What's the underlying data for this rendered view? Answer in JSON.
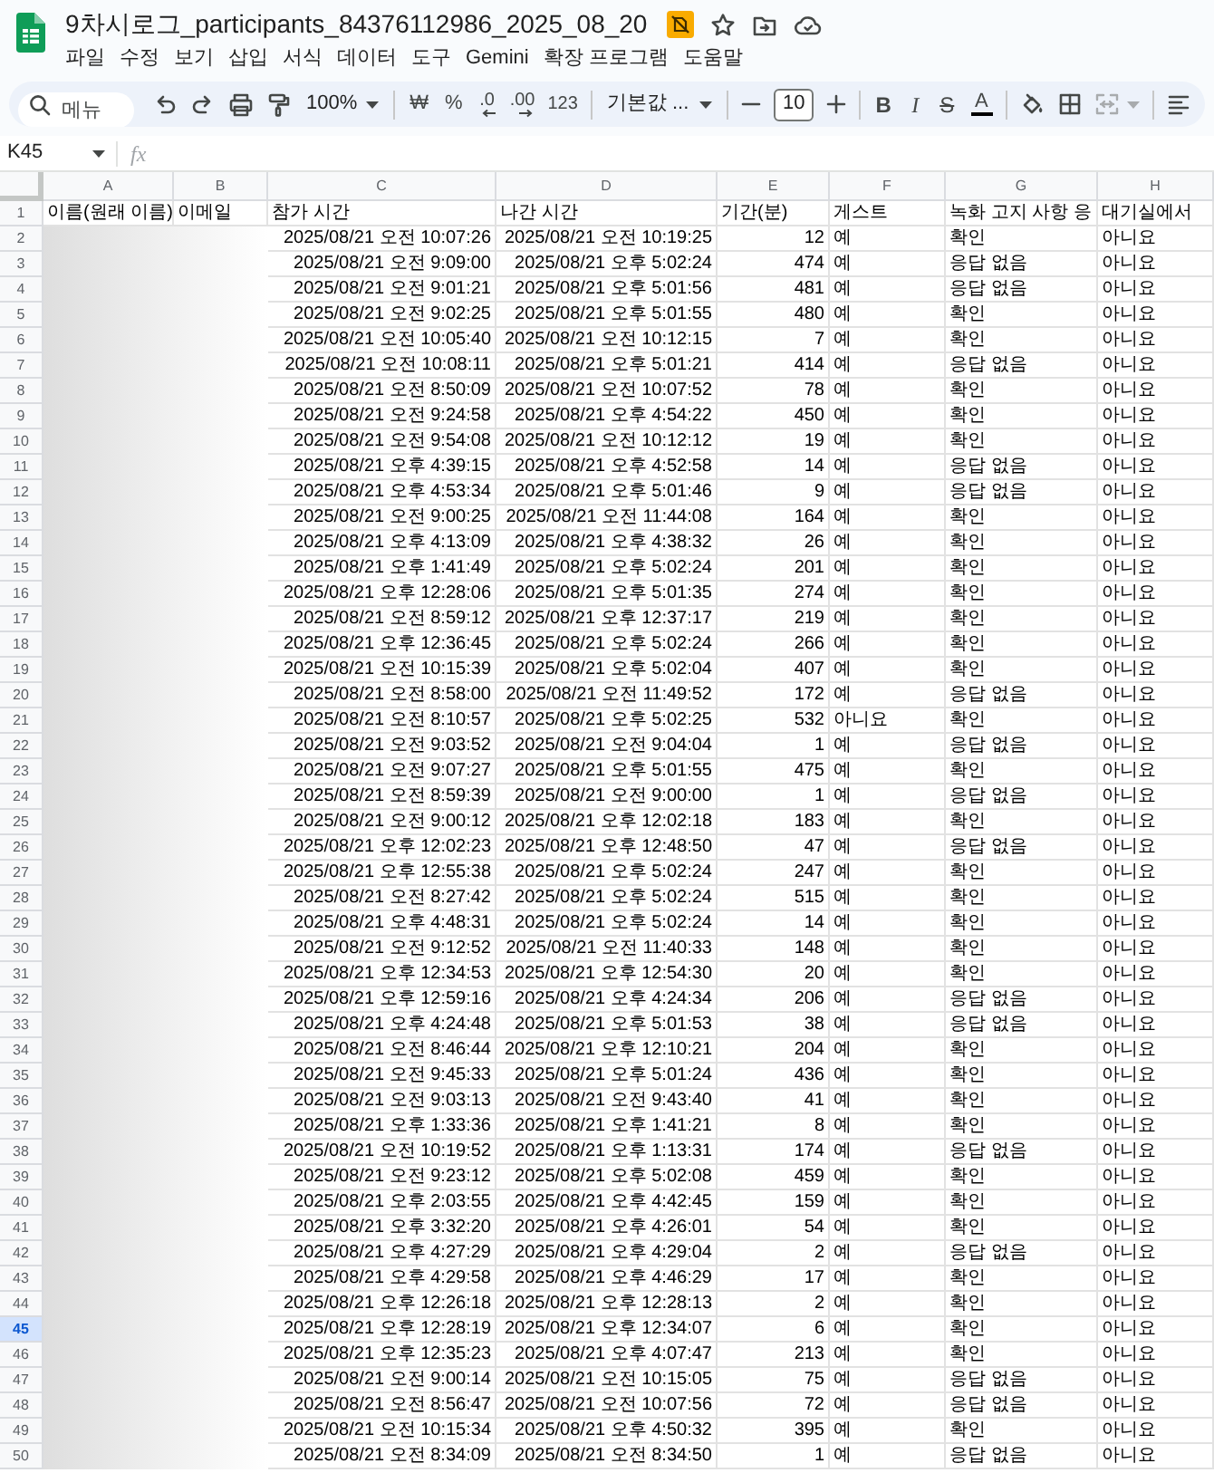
{
  "document": {
    "title": "9차시로그_participants_84376112986_2025_08_20",
    "menu": [
      "파일",
      "수정",
      "보기",
      "삽입",
      "서식",
      "데이터",
      "도구",
      "Gemini",
      "확장 프로그램",
      "도움말"
    ]
  },
  "toolbar": {
    "search": {
      "placeholder": "메뉴"
    },
    "zoom": "100%",
    "currency": "₩",
    "percent": "%",
    "decrease_decimal": ".0",
    "increase_decimal": ".00",
    "number_format": "123",
    "font": "기본값 ...",
    "font_size": "10",
    "bold": "B",
    "italic": "I",
    "strikethrough": "S",
    "text_color": "A"
  },
  "formula_bar": {
    "cell_reference": "K45",
    "fx": "fx"
  },
  "sheet": {
    "columns": [
      "A",
      "B",
      "C",
      "D",
      "E",
      "F",
      "G",
      "H"
    ],
    "header_row": {
      "number": "1",
      "selected": false,
      "cells": [
        "이름(원래 이름)",
        "이메일",
        "참가 시간",
        "나간 시간",
        "기간(분)",
        "게스트",
        "녹화 고지 사항 응",
        "대기실에서"
      ]
    },
    "rows": [
      {
        "number": "2",
        "selected": false,
        "cells": [
          "",
          "",
          "2025/08/21 오전 10:07:26",
          "2025/08/21 오전 10:19:25",
          "12",
          "예",
          "확인",
          "아니요"
        ]
      },
      {
        "number": "3",
        "selected": false,
        "cells": [
          "",
          "",
          "2025/08/21 오전 9:09:00",
          "2025/08/21 오후 5:02:24",
          "474",
          "예",
          "응답 없음",
          "아니요"
        ]
      },
      {
        "number": "4",
        "selected": false,
        "cells": [
          "",
          "",
          "2025/08/21 오전 9:01:21",
          "2025/08/21 오후 5:01:56",
          "481",
          "예",
          "응답 없음",
          "아니요"
        ]
      },
      {
        "number": "5",
        "selected": false,
        "cells": [
          "",
          "",
          "2025/08/21 오전 9:02:25",
          "2025/08/21 오후 5:01:55",
          "480",
          "예",
          "확인",
          "아니요"
        ]
      },
      {
        "number": "6",
        "selected": false,
        "cells": [
          "",
          "",
          "2025/08/21 오전 10:05:40",
          "2025/08/21 오전 10:12:15",
          "7",
          "예",
          "확인",
          "아니요"
        ]
      },
      {
        "number": "7",
        "selected": false,
        "cells": [
          "",
          "",
          "2025/08/21 오전 10:08:11",
          "2025/08/21 오후 5:01:21",
          "414",
          "예",
          "응답 없음",
          "아니요"
        ]
      },
      {
        "number": "8",
        "selected": false,
        "cells": [
          "",
          "",
          "2025/08/21 오전 8:50:09",
          "2025/08/21 오전 10:07:52",
          "78",
          "예",
          "확인",
          "아니요"
        ]
      },
      {
        "number": "9",
        "selected": false,
        "cells": [
          "",
          "",
          "2025/08/21 오전 9:24:58",
          "2025/08/21 오후 4:54:22",
          "450",
          "예",
          "확인",
          "아니요"
        ]
      },
      {
        "number": "10",
        "selected": false,
        "cells": [
          "",
          "",
          "2025/08/21 오전 9:54:08",
          "2025/08/21 오전 10:12:12",
          "19",
          "예",
          "확인",
          "아니요"
        ]
      },
      {
        "number": "11",
        "selected": false,
        "cells": [
          "",
          "",
          "2025/08/21 오후 4:39:15",
          "2025/08/21 오후 4:52:58",
          "14",
          "예",
          "응답 없음",
          "아니요"
        ]
      },
      {
        "number": "12",
        "selected": false,
        "cells": [
          "",
          "",
          "2025/08/21 오후 4:53:34",
          "2025/08/21 오후 5:01:46",
          "9",
          "예",
          "응답 없음",
          "아니요"
        ]
      },
      {
        "number": "13",
        "selected": false,
        "cells": [
          "",
          "",
          "2025/08/21 오전 9:00:25",
          "2025/08/21 오전 11:44:08",
          "164",
          "예",
          "확인",
          "아니요"
        ]
      },
      {
        "number": "14",
        "selected": false,
        "cells": [
          "",
          "",
          "2025/08/21 오후 4:13:09",
          "2025/08/21 오후 4:38:32",
          "26",
          "예",
          "확인",
          "아니요"
        ]
      },
      {
        "number": "15",
        "selected": false,
        "cells": [
          "",
          "",
          "2025/08/21 오후 1:41:49",
          "2025/08/21 오후 5:02:24",
          "201",
          "예",
          "확인",
          "아니요"
        ]
      },
      {
        "number": "16",
        "selected": false,
        "cells": [
          "",
          "",
          "2025/08/21 오후 12:28:06",
          "2025/08/21 오후 5:01:35",
          "274",
          "예",
          "확인",
          "아니요"
        ]
      },
      {
        "number": "17",
        "selected": false,
        "cells": [
          "",
          "",
          "2025/08/21 오전 8:59:12",
          "2025/08/21 오후 12:37:17",
          "219",
          "예",
          "확인",
          "아니요"
        ]
      },
      {
        "number": "18",
        "selected": false,
        "cells": [
          "",
          "",
          "2025/08/21 오후 12:36:45",
          "2025/08/21 오후 5:02:24",
          "266",
          "예",
          "확인",
          "아니요"
        ]
      },
      {
        "number": "19",
        "selected": false,
        "cells": [
          "",
          "",
          "2025/08/21 오전 10:15:39",
          "2025/08/21 오후 5:02:04",
          "407",
          "예",
          "확인",
          "아니요"
        ]
      },
      {
        "number": "20",
        "selected": false,
        "cells": [
          "",
          "",
          "2025/08/21 오전 8:58:00",
          "2025/08/21 오전 11:49:52",
          "172",
          "예",
          "응답 없음",
          "아니요"
        ]
      },
      {
        "number": "21",
        "selected": false,
        "cells": [
          "",
          "",
          "2025/08/21 오전 8:10:57",
          "2025/08/21 오후 5:02:25",
          "532",
          "아니요",
          "확인",
          "아니요"
        ]
      },
      {
        "number": "22",
        "selected": false,
        "cells": [
          "",
          "",
          "2025/08/21 오전 9:03:52",
          "2025/08/21 오전 9:04:04",
          "1",
          "예",
          "응답 없음",
          "아니요"
        ]
      },
      {
        "number": "23",
        "selected": false,
        "cells": [
          "",
          "",
          "2025/08/21 오전 9:07:27",
          "2025/08/21 오후 5:01:55",
          "475",
          "예",
          "확인",
          "아니요"
        ]
      },
      {
        "number": "24",
        "selected": false,
        "cells": [
          "",
          "",
          "2025/08/21 오전 8:59:39",
          "2025/08/21 오전 9:00:00",
          "1",
          "예",
          "응답 없음",
          "아니요"
        ]
      },
      {
        "number": "25",
        "selected": false,
        "cells": [
          "",
          "",
          "2025/08/21 오전 9:00:12",
          "2025/08/21 오후 12:02:18",
          "183",
          "예",
          "확인",
          "아니요"
        ]
      },
      {
        "number": "26",
        "selected": false,
        "cells": [
          "",
          "",
          "2025/08/21 오후 12:02:23",
          "2025/08/21 오후 12:48:50",
          "47",
          "예",
          "응답 없음",
          "아니요"
        ]
      },
      {
        "number": "27",
        "selected": false,
        "cells": [
          "",
          "",
          "2025/08/21 오후 12:55:38",
          "2025/08/21 오후 5:02:24",
          "247",
          "예",
          "확인",
          "아니요"
        ]
      },
      {
        "number": "28",
        "selected": false,
        "cells": [
          "",
          "",
          "2025/08/21 오전 8:27:42",
          "2025/08/21 오후 5:02:24",
          "515",
          "예",
          "확인",
          "아니요"
        ]
      },
      {
        "number": "29",
        "selected": false,
        "cells": [
          "",
          "",
          "2025/08/21 오후 4:48:31",
          "2025/08/21 오후 5:02:24",
          "14",
          "예",
          "확인",
          "아니요"
        ]
      },
      {
        "number": "30",
        "selected": false,
        "cells": [
          "",
          "",
          "2025/08/21 오전 9:12:52",
          "2025/08/21 오전 11:40:33",
          "148",
          "예",
          "확인",
          "아니요"
        ]
      },
      {
        "number": "31",
        "selected": false,
        "cells": [
          "",
          "",
          "2025/08/21 오후 12:34:53",
          "2025/08/21 오후 12:54:30",
          "20",
          "예",
          "확인",
          "아니요"
        ]
      },
      {
        "number": "32",
        "selected": false,
        "cells": [
          "",
          "",
          "2025/08/21 오후 12:59:16",
          "2025/08/21 오후 4:24:34",
          "206",
          "예",
          "응답 없음",
          "아니요"
        ]
      },
      {
        "number": "33",
        "selected": false,
        "cells": [
          "",
          "",
          "2025/08/21 오후 4:24:48",
          "2025/08/21 오후 5:01:53",
          "38",
          "예",
          "응답 없음",
          "아니요"
        ]
      },
      {
        "number": "34",
        "selected": false,
        "cells": [
          "",
          "",
          "2025/08/21 오전 8:46:44",
          "2025/08/21 오후 12:10:21",
          "204",
          "예",
          "확인",
          "아니요"
        ]
      },
      {
        "number": "35",
        "selected": false,
        "cells": [
          "",
          "",
          "2025/08/21 오전 9:45:33",
          "2025/08/21 오후 5:01:24",
          "436",
          "예",
          "확인",
          "아니요"
        ]
      },
      {
        "number": "36",
        "selected": false,
        "cells": [
          "",
          "",
          "2025/08/21 오전 9:03:13",
          "2025/08/21 오전 9:43:40",
          "41",
          "예",
          "확인",
          "아니요"
        ]
      },
      {
        "number": "37",
        "selected": false,
        "cells": [
          "",
          "",
          "2025/08/21 오후 1:33:36",
          "2025/08/21 오후 1:41:21",
          "8",
          "예",
          "확인",
          "아니요"
        ]
      },
      {
        "number": "38",
        "selected": false,
        "cells": [
          "",
          "",
          "2025/08/21 오전 10:19:52",
          "2025/08/21 오후 1:13:31",
          "174",
          "예",
          "응답 없음",
          "아니요"
        ]
      },
      {
        "number": "39",
        "selected": false,
        "cells": [
          "",
          "",
          "2025/08/21 오전 9:23:12",
          "2025/08/21 오후 5:02:08",
          "459",
          "예",
          "확인",
          "아니요"
        ]
      },
      {
        "number": "40",
        "selected": false,
        "cells": [
          "",
          "",
          "2025/08/21 오후 2:03:55",
          "2025/08/21 오후 4:42:45",
          "159",
          "예",
          "확인",
          "아니요"
        ]
      },
      {
        "number": "41",
        "selected": false,
        "cells": [
          "",
          "",
          "2025/08/21 오후 3:32:20",
          "2025/08/21 오후 4:26:01",
          "54",
          "예",
          "확인",
          "아니요"
        ]
      },
      {
        "number": "42",
        "selected": false,
        "cells": [
          "",
          "",
          "2025/08/21 오후 4:27:29",
          "2025/08/21 오후 4:29:04",
          "2",
          "예",
          "응답 없음",
          "아니요"
        ]
      },
      {
        "number": "43",
        "selected": false,
        "cells": [
          "",
          "",
          "2025/08/21 오후 4:29:58",
          "2025/08/21 오후 4:46:29",
          "17",
          "예",
          "확인",
          "아니요"
        ]
      },
      {
        "number": "44",
        "selected": false,
        "cells": [
          "",
          "",
          "2025/08/21 오후 12:26:18",
          "2025/08/21 오후 12:28:13",
          "2",
          "예",
          "확인",
          "아니요"
        ]
      },
      {
        "number": "45",
        "selected": true,
        "cells": [
          "",
          "",
          "2025/08/21 오후 12:28:19",
          "2025/08/21 오후 12:34:07",
          "6",
          "예",
          "확인",
          "아니요"
        ]
      },
      {
        "number": "46",
        "selected": false,
        "cells": [
          "",
          "",
          "2025/08/21 오후 12:35:23",
          "2025/08/21 오후 4:07:47",
          "213",
          "예",
          "확인",
          "아니요"
        ]
      },
      {
        "number": "47",
        "selected": false,
        "cells": [
          "",
          "",
          "2025/08/21 오전 9:00:14",
          "2025/08/21 오전 10:15:05",
          "75",
          "예",
          "응답 없음",
          "아니요"
        ]
      },
      {
        "number": "48",
        "selected": false,
        "cells": [
          "",
          "",
          "2025/08/21 오전 8:56:47",
          "2025/08/21 오전 10:07:56",
          "72",
          "예",
          "응답 없음",
          "아니요"
        ]
      },
      {
        "number": "49",
        "selected": false,
        "cells": [
          "",
          "",
          "2025/08/21 오전 10:15:34",
          "2025/08/21 오후 4:50:32",
          "395",
          "예",
          "확인",
          "아니요"
        ]
      },
      {
        "number": "50",
        "selected": false,
        "cells": [
          "",
          "",
          "2025/08/21 오전 8:34:09",
          "2025/08/21 오전 8:34:50",
          "1",
          "예",
          "응답 없음",
          "아니요"
        ]
      }
    ]
  }
}
